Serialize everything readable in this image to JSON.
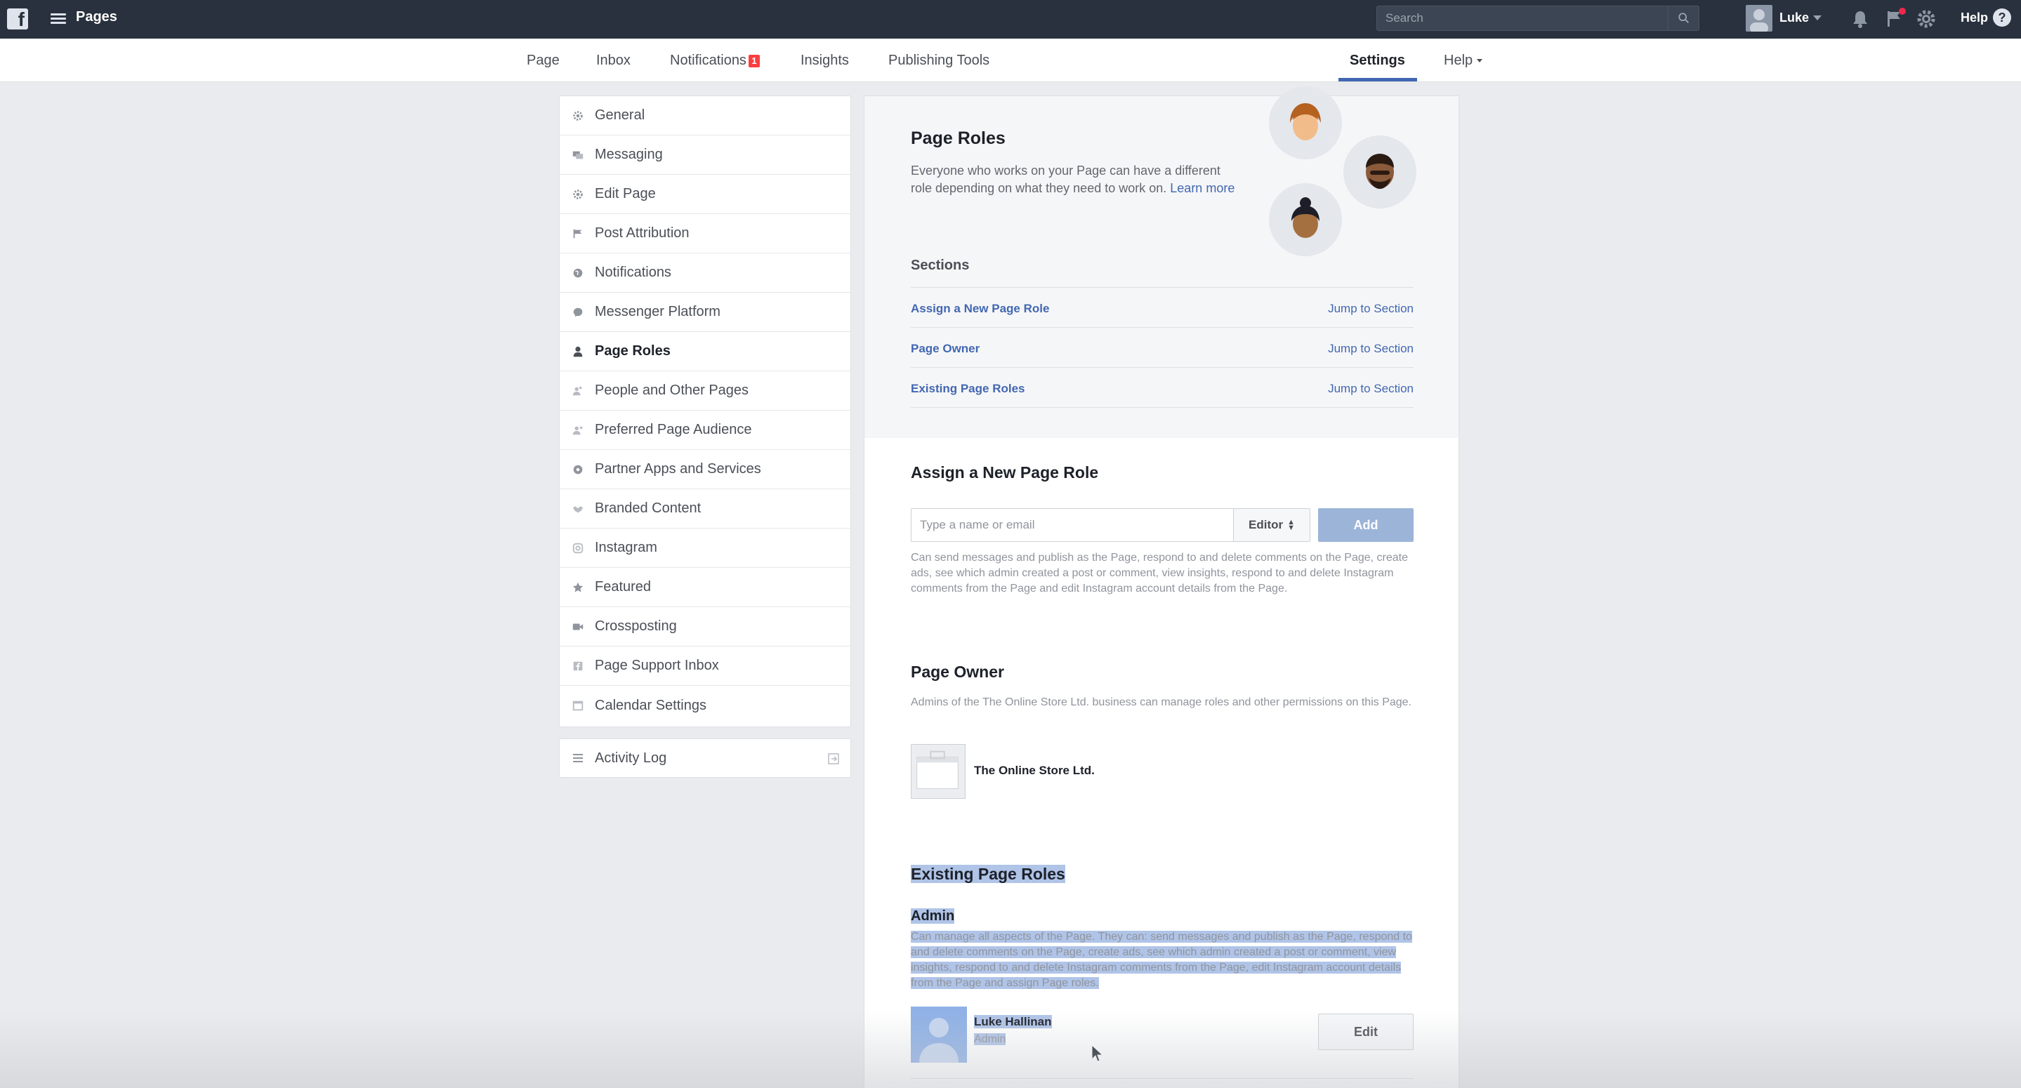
{
  "topbar": {
    "app_title": "Pages",
    "search_placeholder": "Search",
    "user_name": "Luke",
    "help_label": "Help",
    "help_glyph": "?"
  },
  "pagenav": {
    "tabs": [
      {
        "label": "Page"
      },
      {
        "label": "Inbox"
      },
      {
        "label": "Notifications",
        "badge": "1"
      },
      {
        "label": "Insights"
      },
      {
        "label": "Publishing Tools"
      },
      {
        "label": "Settings"
      },
      {
        "label": "Help"
      }
    ]
  },
  "sidebar": {
    "items": [
      {
        "label": "General",
        "icon": "gear-icon"
      },
      {
        "label": "Messaging",
        "icon": "messages-icon"
      },
      {
        "label": "Edit Page",
        "icon": "gear-icon"
      },
      {
        "label": "Post Attribution",
        "icon": "flag-icon"
      },
      {
        "label": "Notifications",
        "icon": "globe-icon"
      },
      {
        "label": "Messenger Platform",
        "icon": "messenger-icon"
      },
      {
        "label": "Page Roles",
        "icon": "person-icon"
      },
      {
        "label": "People and Other Pages",
        "icon": "people-icon"
      },
      {
        "label": "Preferred Page Audience",
        "icon": "audience-icon"
      },
      {
        "label": "Partner Apps and Services",
        "icon": "apps-icon"
      },
      {
        "label": "Branded Content",
        "icon": "handshake-icon"
      },
      {
        "label": "Instagram",
        "icon": "instagram-icon"
      },
      {
        "label": "Featured",
        "icon": "star-icon"
      },
      {
        "label": "Crossposting",
        "icon": "video-icon"
      },
      {
        "label": "Page Support Inbox",
        "icon": "facebook-icon"
      },
      {
        "label": "Calendar Settings",
        "icon": "calendar-icon"
      }
    ],
    "activity_log": "Activity Log"
  },
  "page_roles": {
    "title": "Page Roles",
    "description": "Everyone who works on your Page can have a different role depending on what they need to work on.",
    "learn_more": "Learn more",
    "sections_title": "Sections",
    "sections": [
      {
        "label": "Assign a New Page Role",
        "jump": "Jump to Section"
      },
      {
        "label": "Page Owner",
        "jump": "Jump to Section"
      },
      {
        "label": "Existing Page Roles",
        "jump": "Jump to Section"
      }
    ]
  },
  "assign": {
    "title": "Assign a New Page Role",
    "input_placeholder": "Type a name or email",
    "role_selected": "Editor",
    "add_label": "Add",
    "role_description": "Can send messages and publish as the Page, respond to and delete comments on the Page, create ads, see which admin created a post or comment, view insights, respond to and delete Instagram comments from the Page and edit Instagram account details from the Page."
  },
  "owner": {
    "title": "Page Owner",
    "description": "Admins of the The Online Store Ltd. business can manage roles and other permissions on this Page.",
    "name": "The Online Store Ltd."
  },
  "existing": {
    "title": "Existing Page Roles",
    "role_title": "Admin",
    "role_description": "Can manage all aspects of the Page. They can: send messages and publish as the Page, respond to and delete comments on the Page, create ads, see which admin created a post or comment, view insights, respond to and delete Instagram comments from the Page, edit Instagram account details from the Page and assign Page roles.",
    "person_name": "Luke Hallinan",
    "person_role": "Admin",
    "edit_label": "Edit"
  },
  "colors": {
    "topbar": "#28313d",
    "link": "#4267b2",
    "badge": "#fa3e3e",
    "add_button": "#9cb4d8",
    "highlight": "#b0c4e8"
  }
}
